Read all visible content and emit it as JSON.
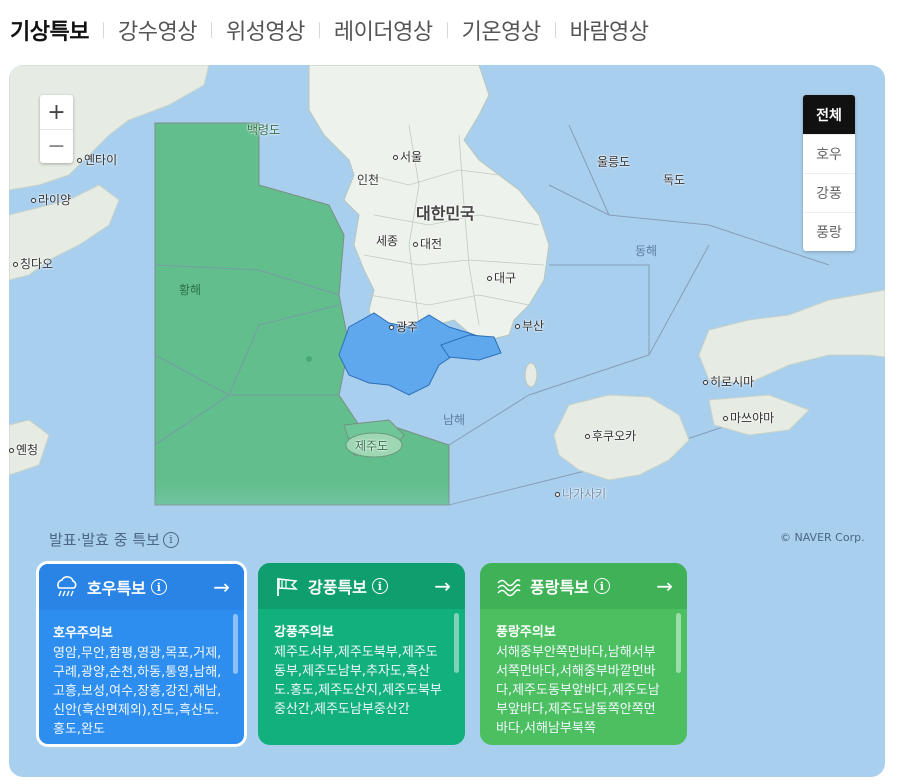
{
  "tabs": [
    {
      "label": "기상특보",
      "active": true
    },
    {
      "label": "강수영상"
    },
    {
      "label": "위성영상"
    },
    {
      "label": "레이더영상"
    },
    {
      "label": "기온영상"
    },
    {
      "label": "바람영상"
    }
  ],
  "map": {
    "zoom_in": "+",
    "zoom_out": "−",
    "filters": [
      "전체",
      "호우",
      "강풍",
      "풍랑"
    ],
    "labels": {
      "baengnyeong": "백령도",
      "yantai": "옌타이",
      "laiyang": "라이양",
      "qingdao": "칭다오",
      "seoul": "서울",
      "incheon": "인천",
      "korea": "대한민국",
      "sejong": "세종",
      "daejeon": "대전",
      "daegu": "대구",
      "gwangju": "광주",
      "busan": "부산",
      "ulleungdo": "울릉도",
      "dokdo": "독도",
      "east_sea": "동해",
      "yellow_sea": "황해",
      "south_sea": "남해",
      "jeju": "제주도",
      "hiroshima": "히로시마",
      "matsuyama": "마쓰야마",
      "fukuoka": "후쿠오카",
      "nagasaki": "나가사키",
      "yancheng": "옌청"
    },
    "copyright": "© NAVER Corp."
  },
  "issued_label": "발표·발효 중 특보",
  "info_glyph": "i",
  "cards": [
    {
      "title": "호우특보",
      "icon": "rain-cloud-icon",
      "color": "#2e8ef0",
      "arrow": "→",
      "subtitle": "호우주의보",
      "areas": "영암,무안,함평,영광,목포,거제,구례,광양,순천,하동,통영,남해,고흥,보성,여수,장흥,강진,해남,신안(흑산면제외),진도,흑산도.홍도,완도"
    },
    {
      "title": "강풍특보",
      "icon": "flag-wind-icon",
      "color": "#12b07c",
      "arrow": "→",
      "subtitle": "강풍주의보",
      "areas": "제주도서부,제주도북부,제주도동부,제주도남부,추자도,흑산도.홍도,제주도산지,제주도북부중산간,제주도남부중산간"
    },
    {
      "title": "풍랑특보",
      "icon": "wave-icon",
      "color": "#4cbf61",
      "arrow": "→",
      "subtitle": "풍랑주의보",
      "areas": "서해중부안쪽먼바다,남해서부서쪽먼바다,서해중부바깥먼바다,제주도동부앞바다,제주도남부앞바다,제주도남동쪽안쪽먼바다,서해남부북쪽"
    }
  ]
}
